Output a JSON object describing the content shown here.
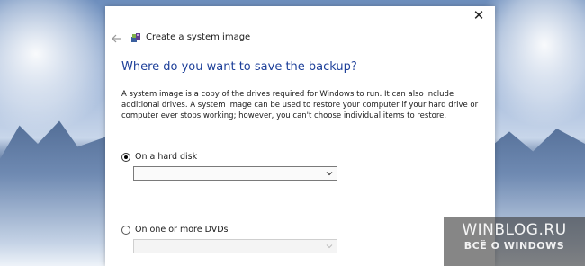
{
  "window": {
    "title": "Create a system image",
    "close_glyph": "✕",
    "back_icon": "arrow-left-icon",
    "app_icon": "system-image-icon"
  },
  "content": {
    "heading": "Where do you want to save the backup?",
    "description": "A system image is a copy of the drives required for Windows to run. It can also include additional drives. A system image can be used to restore your computer if your hard drive or computer ever stops working; however, you can't choose individual items to restore."
  },
  "options": {
    "hard_disk": {
      "label": "On a hard disk",
      "selected": true,
      "dropdown_value": "",
      "dropdown_enabled": true
    },
    "dvds": {
      "label": "On one or more DVDs",
      "selected": false,
      "dropdown_value": "",
      "dropdown_enabled": false
    }
  },
  "watermark": {
    "line1": "WINBLOG.RU",
    "line2": "ВСЁ О WINDOWS"
  },
  "colors": {
    "heading": "#1d3f99",
    "window_bg": "#ffffff",
    "watermark_bg": "#3c3c3c"
  }
}
